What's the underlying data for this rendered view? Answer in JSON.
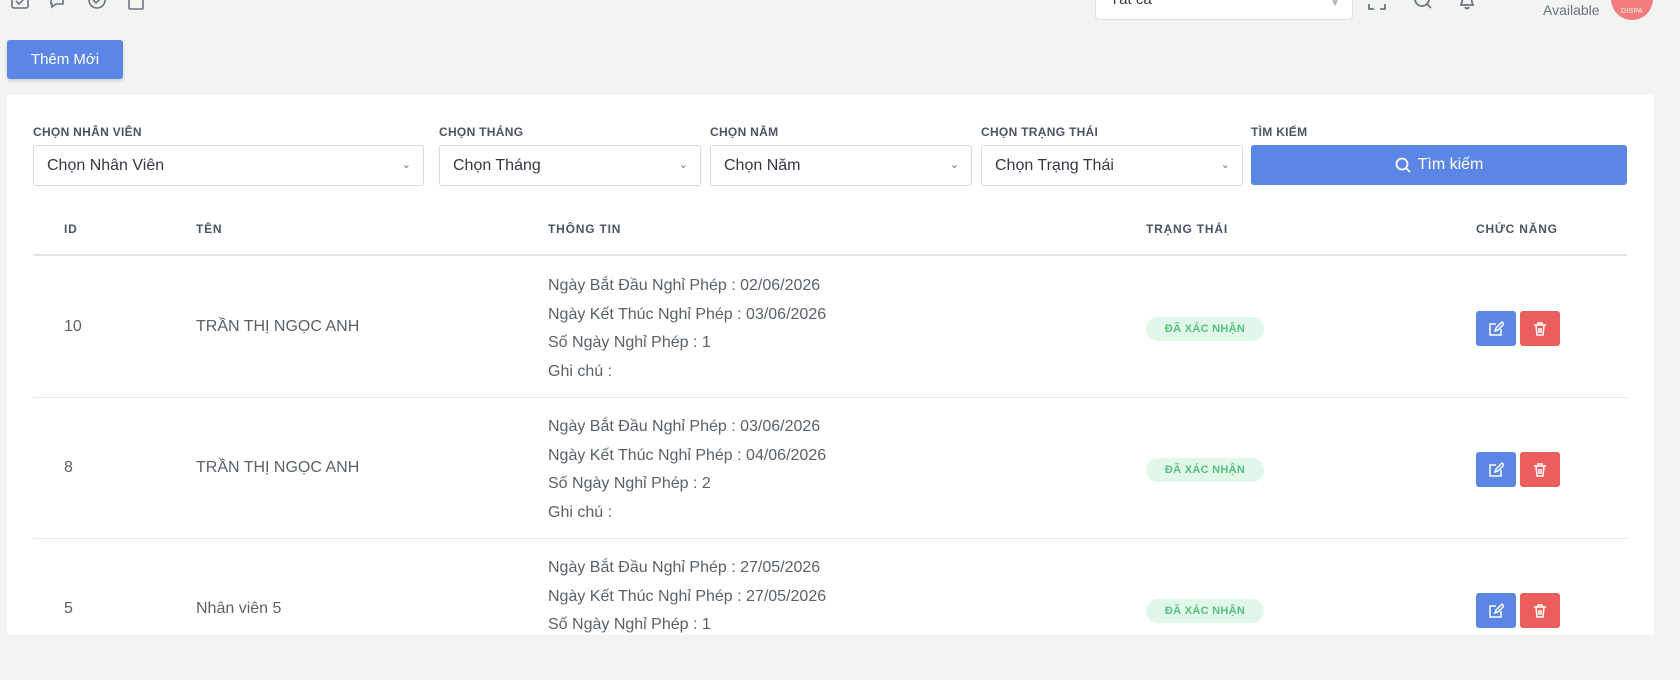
{
  "header": {
    "filter_value": "Tất cả",
    "status_text": "Available",
    "avatar_text": "DISPA"
  },
  "toolbar": {
    "add_label": "Thêm Mới"
  },
  "filters": {
    "employee": {
      "label": "CHỌN NHÂN VIÊN",
      "value": "Chọn Nhân Viên"
    },
    "month": {
      "label": "CHỌN THÁNG",
      "value": "Chọn Tháng"
    },
    "year": {
      "label": "CHỌN NĂM",
      "value": "Chọn Năm"
    },
    "status": {
      "label": "CHỌN TRẠNG THÁI",
      "value": "Chọn Trạng Thái"
    },
    "search": {
      "label": "TÌM KIẾM",
      "button": "Tìm kiếm"
    }
  },
  "table": {
    "columns": [
      "ID",
      "TÊN",
      "THÔNG TIN",
      "TRẠNG THÁI",
      "CHỨC NĂNG"
    ],
    "rows": [
      {
        "id": "10",
        "name": "TRẦN THỊ NGỌC ANH",
        "info": [
          "Ngày Bắt Đầu Nghỉ Phép : 02/06/2026",
          "Ngày Kết Thúc Nghỉ Phép : 03/06/2026",
          "Số Ngày Nghỉ Phép : 1",
          "Ghi chú :"
        ],
        "status": "ĐÃ XÁC NHẬN"
      },
      {
        "id": "8",
        "name": "TRẦN THỊ NGỌC ANH",
        "info": [
          "Ngày Bắt Đầu Nghỉ Phép : 03/06/2026",
          "Ngày Kết Thúc Nghỉ Phép : 04/06/2026",
          "Số Ngày Nghỉ Phép : 2",
          "Ghi chú :"
        ],
        "status": "ĐÃ XÁC NHẬN"
      },
      {
        "id": "5",
        "name": "Nhân viên 5",
        "info": [
          "Ngày Bắt Đầu Nghỉ Phép : 27/05/2026",
          "Ngày Kết Thúc Nghỉ Phép : 27/05/2026",
          "Số Ngày Nghỉ Phép : 1"
        ],
        "status": "ĐÃ XÁC NHẬN"
      }
    ]
  },
  "icons": {
    "header": [
      "calendar-check-icon",
      "chat-icon",
      "shield-icon",
      "clipboard-icon",
      "fullscreen-icon",
      "search-icon",
      "bell-icon"
    ],
    "row_actions": [
      "edit-icon",
      "trash-icon"
    ]
  },
  "colors": {
    "primary": "#5b86e5",
    "danger": "#eb5e5e",
    "success_text": "#53c27e",
    "success_bg": "#e1f7ea"
  }
}
